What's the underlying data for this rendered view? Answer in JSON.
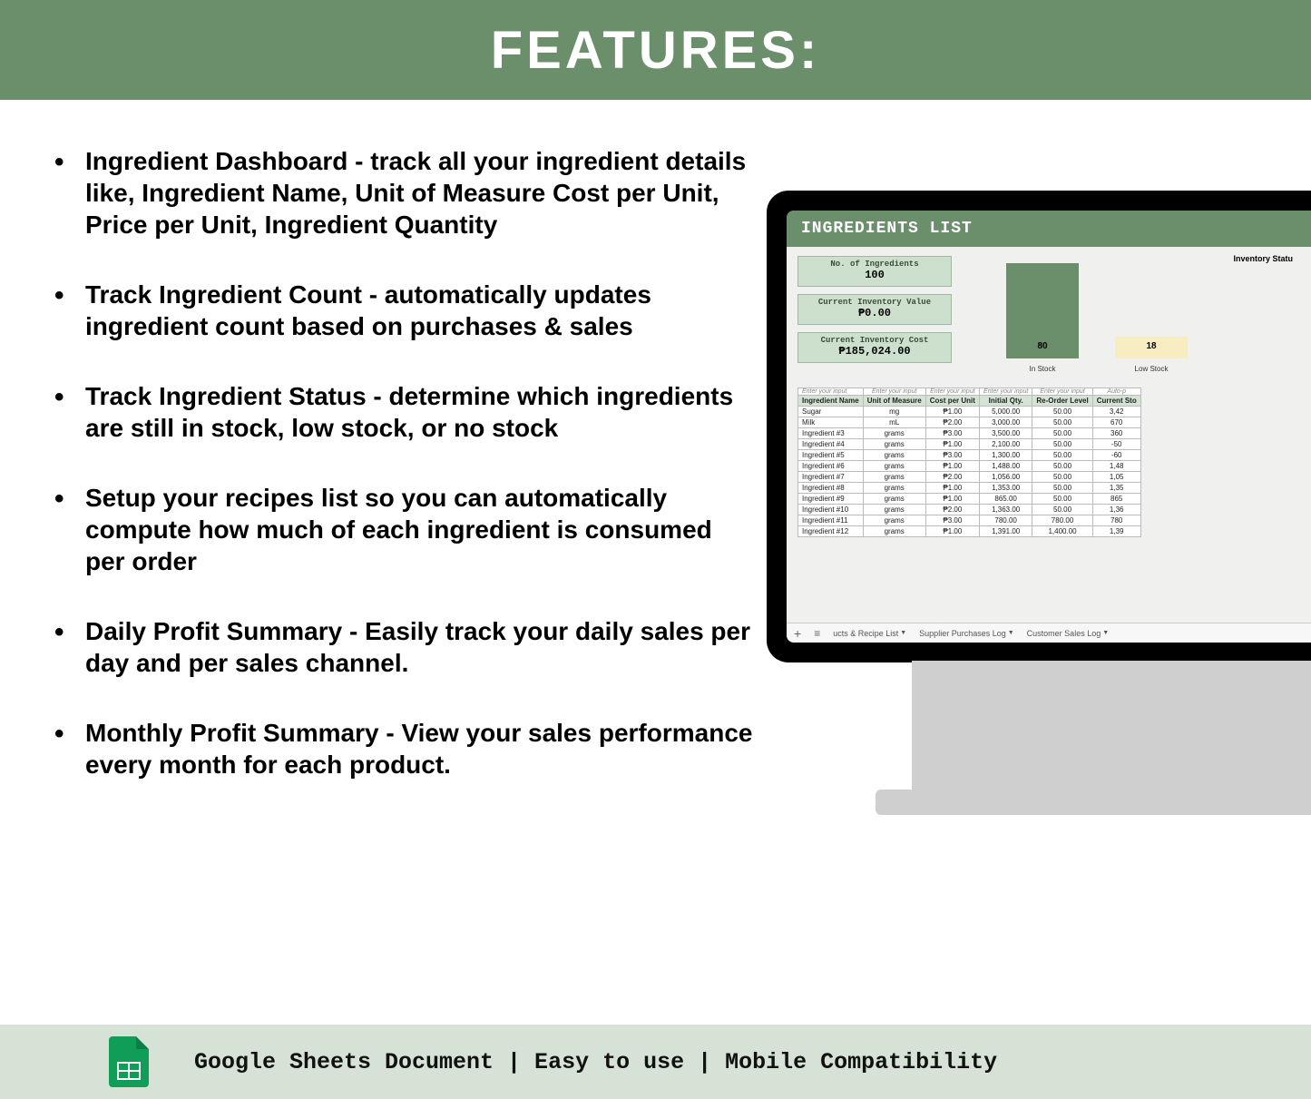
{
  "header": {
    "title": "FEATURES:"
  },
  "features": [
    "Ingredient Dashboard - track all your ingredient details like,  Ingredient Name, Unit of Measure Cost per Unit, Price per Unit, Ingredient Quantity",
    "Track Ingredient Count - automatically updates ingredient count based on purchases & sales",
    "Track Ingredient Status - determine which ingredients are still in stock, low stock, or no stock",
    "Setup your recipes list so you can automatically compute how much of each ingredient is consumed per order",
    "Daily Profit Summary - Easily track your daily sales per day and per sales channel.",
    "Monthly Profit Summary - View your sales performance every month for each product."
  ],
  "mockup": {
    "title": "INGREDIENTS LIST",
    "kpis": [
      {
        "label": "No. of Ingredients",
        "value": "100"
      },
      {
        "label": "Current Inventory Value",
        "value": "₱0.00"
      },
      {
        "label": "Current Inventory Cost",
        "value": "₱185,024.00"
      }
    ],
    "chart_title": "Inventory Statu",
    "chart_data": {
      "type": "bar",
      "categories": [
        "In Stock",
        "Low Stock"
      ],
      "values": [
        80,
        18
      ],
      "title": "Inventory Status",
      "xlabel": "",
      "ylabel": "",
      "ylim": [
        0,
        100
      ]
    },
    "hint_normal": "Enter your input",
    "hint_auto": "Auto-p",
    "columns": [
      "Ingredient Name",
      "Unit of Measure",
      "Cost per Unit",
      "Initial Qty.",
      "Re-Order Level",
      "Current Sto"
    ],
    "rows": [
      [
        "Sugar",
        "mg",
        "₱1.00",
        "5,000.00",
        "50.00",
        "3,42"
      ],
      [
        "Milk",
        "mL",
        "₱2.00",
        "3,000.00",
        "50.00",
        "670"
      ],
      [
        "Ingredient #3",
        "grams",
        "₱3.00",
        "3,500.00",
        "50.00",
        "360"
      ],
      [
        "Ingredient #4",
        "grams",
        "₱1.00",
        "2,100.00",
        "50.00",
        "-50"
      ],
      [
        "Ingredient #5",
        "grams",
        "₱3.00",
        "1,300.00",
        "50.00",
        "-60"
      ],
      [
        "Ingredient #6",
        "grams",
        "₱1.00",
        "1,488.00",
        "50.00",
        "1,48"
      ],
      [
        "Ingredient #7",
        "grams",
        "₱2.00",
        "1,056.00",
        "50.00",
        "1,05"
      ],
      [
        "Ingredient #8",
        "grams",
        "₱1.00",
        "1,353.00",
        "50.00",
        "1,35"
      ],
      [
        "Ingredient #9",
        "grams",
        "₱1.00",
        "865.00",
        "50.00",
        "865"
      ],
      [
        "Ingredient #10",
        "grams",
        "₱2.00",
        "1,363.00",
        "50.00",
        "1,36"
      ],
      [
        "Ingredient #11",
        "grams",
        "₱3.00",
        "780.00",
        "780.00",
        "780"
      ],
      [
        "Ingredient #12",
        "grams",
        "₱1.00",
        "1,391.00",
        "1,400.00",
        "1,39"
      ]
    ],
    "tabs": [
      "ucts & Recipe List",
      "Supplier Purchases Log",
      "Customer Sales Log"
    ]
  },
  "footer": {
    "text": "Google Sheets Document  |  Easy to use  |  Mobile Compatibility"
  }
}
